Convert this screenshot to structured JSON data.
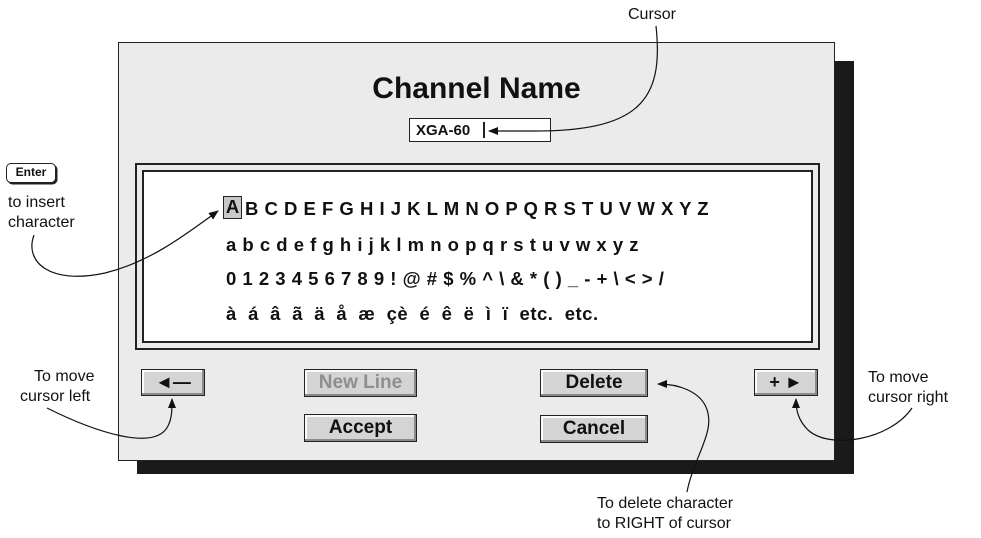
{
  "callouts": {
    "cursor": "Cursor",
    "enter_key": "Enter",
    "enter_line1": "to insert",
    "enter_line2": "character",
    "move_left_line1": "To move",
    "move_left_line2": "cursor left",
    "move_right_line1": "To move",
    "move_right_line2": "cursor right",
    "delete_line1": "To delete character",
    "delete_line2": "to RIGHT of cursor"
  },
  "dialog": {
    "title": "Channel Name",
    "name_value": "XGA-60"
  },
  "character_grid": {
    "selected": "A",
    "row_upper": "B C D E F G H I J K L M N O P Q R S T U V W X Y Z",
    "row_lower": "a b c d e f g h i j k l m n o p q r s t u v w x y z",
    "row_digits": "0 1 2 3 4 5 6 7 8 9 ! @ # $ % ^ \\ & * ( ) _ - + \\ < > /",
    "row_accents": "à  á  â  ã  ä  å  æ  çè  é  ê  ë  ì  ï  etc.  etc."
  },
  "buttons": {
    "left_arrow": "◄—",
    "new_line": "New Line",
    "delete": "Delete",
    "right_arrow": "+ ►",
    "accept": "Accept",
    "cancel": "Cancel"
  },
  "colors": {
    "dialog_bg": "#ebebeb",
    "disabled_text": "#8e8e8e"
  }
}
